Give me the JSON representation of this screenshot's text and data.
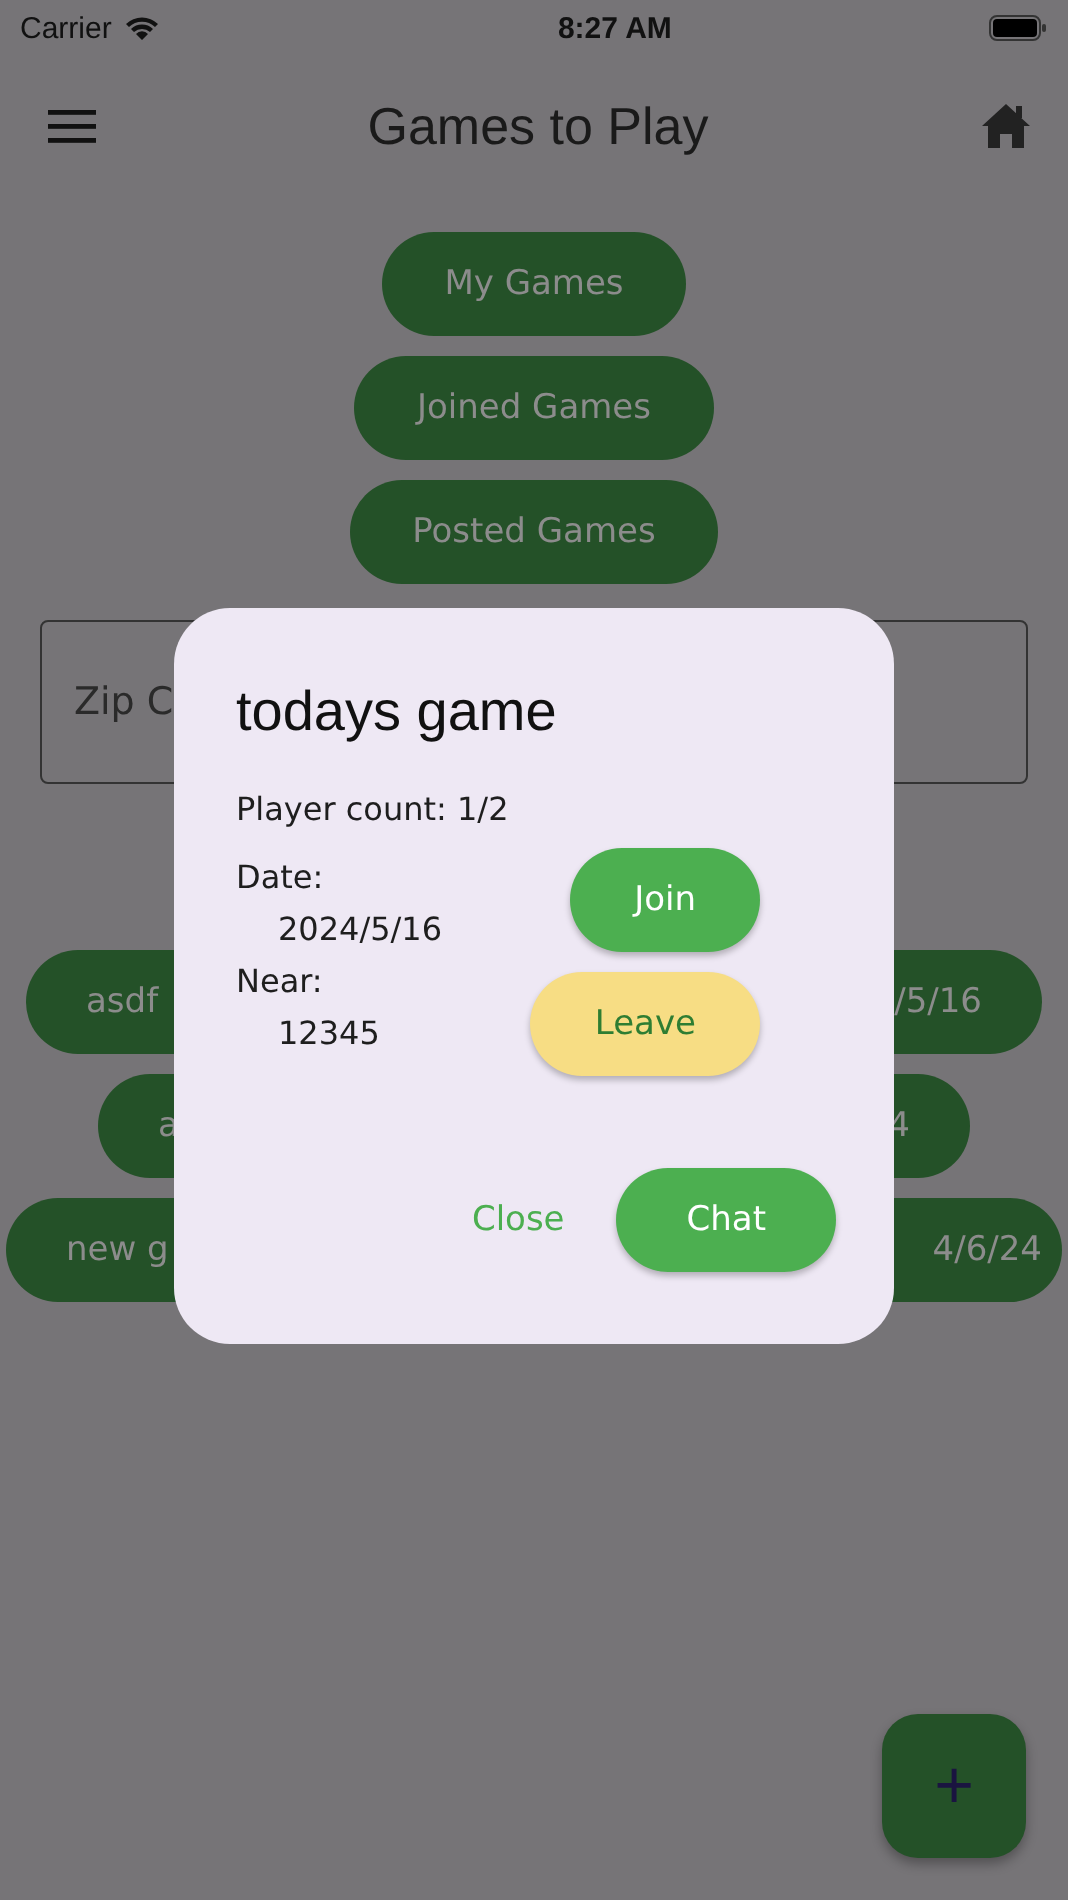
{
  "status_bar": {
    "carrier": "Carrier",
    "time": "8:27 AM"
  },
  "app_bar": {
    "title": "Games to Play"
  },
  "nav_buttons": [
    "My Games",
    "Joined Games",
    "Posted Games"
  ],
  "zip_field": {
    "placeholder": "Zip C"
  },
  "games": [
    {
      "name": "asdf",
      "date": "/5/16"
    },
    {
      "name": "a",
      "date": "4"
    },
    {
      "name": "new g",
      "date": "4/6/24"
    }
  ],
  "dialog": {
    "title": "todays game",
    "player_count": "Player count: 1/2",
    "date_label": "Date:",
    "date": "2024/5/16",
    "near_label": "Near:",
    "near": "12345",
    "actions": [
      {
        "label": "Join",
        "kind": "primary"
      },
      {
        "label": "Leave",
        "kind": "warning"
      }
    ],
    "footer": [
      {
        "label": "Close",
        "kind": "text"
      },
      {
        "label": "Chat",
        "kind": "primary"
      }
    ]
  },
  "fab": {
    "label": "+"
  }
}
